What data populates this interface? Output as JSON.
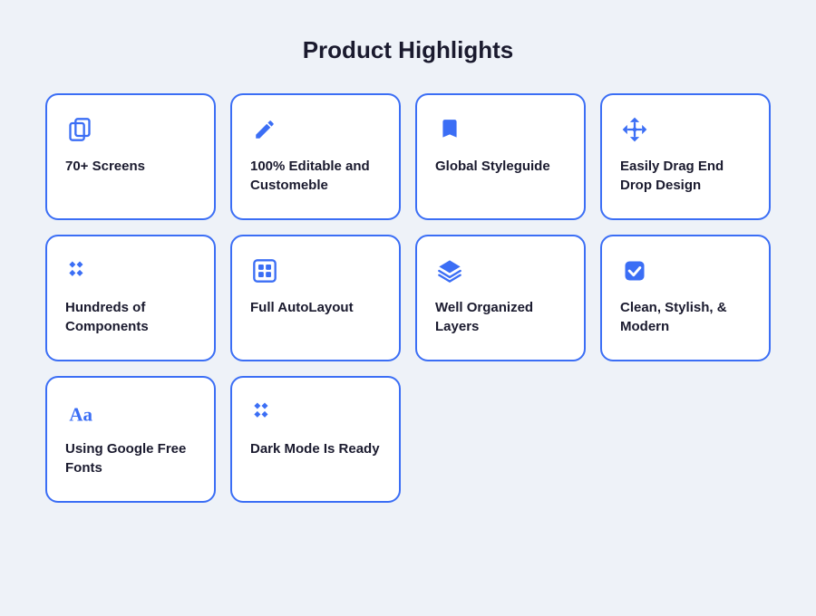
{
  "page": {
    "title": "Product Highlights",
    "cards": [
      {
        "id": "screens",
        "label": "70+ Screens",
        "icon": "copy"
      },
      {
        "id": "editable",
        "label": "100% Editable and Customeble",
        "icon": "pencil"
      },
      {
        "id": "styleguide",
        "label": "Global Styleguide",
        "icon": "bookmark"
      },
      {
        "id": "drag-drop",
        "label": "Easily Drag End Drop Design",
        "icon": "move"
      },
      {
        "id": "components",
        "label": "Hundreds of Components",
        "icon": "diamond"
      },
      {
        "id": "autolayout",
        "label": "Full AutoLayout",
        "icon": "autolayout"
      },
      {
        "id": "layers",
        "label": "Well Organized Layers",
        "icon": "layers"
      },
      {
        "id": "modern",
        "label": "Clean, Stylish, & Modern",
        "icon": "check"
      },
      {
        "id": "fonts",
        "label": "Using Google Free Fonts",
        "icon": "text"
      },
      {
        "id": "darkmode",
        "label": "Dark Mode Is Ready",
        "icon": "diamond2"
      }
    ]
  }
}
